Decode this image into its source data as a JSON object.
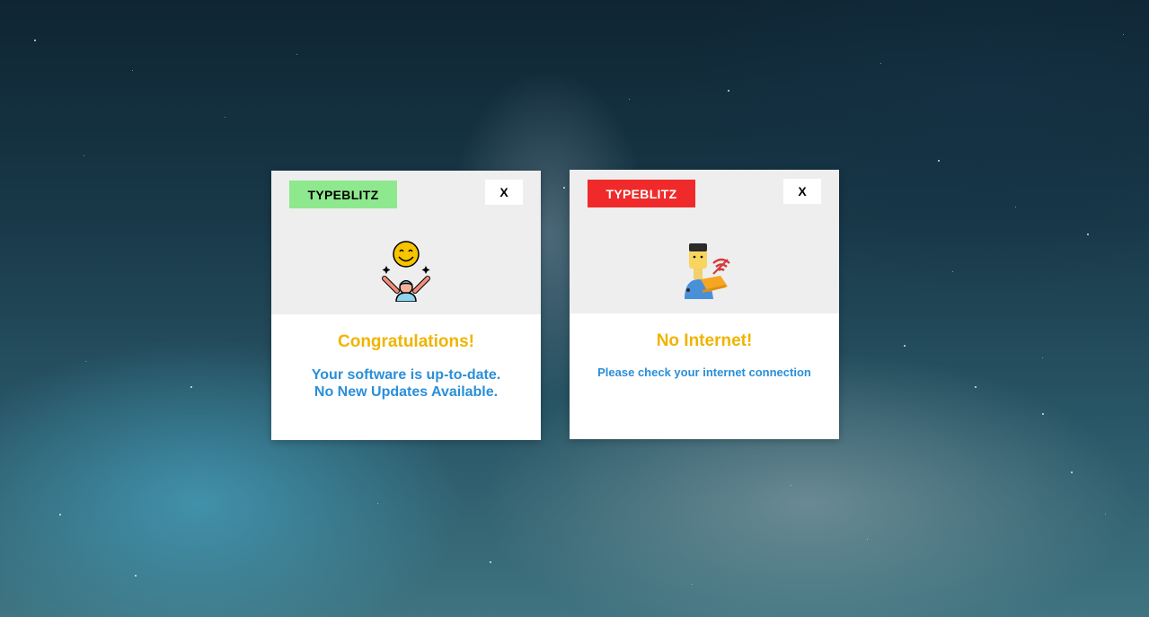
{
  "dialogs": [
    {
      "brand": "TYPEBLITZ",
      "brand_color": "#8ee88e",
      "close_label": "X",
      "icon": "celebrating-person-icon",
      "headline": "Congratulations!",
      "message_line1": "Your software is up-to-date.",
      "message_line2": "No New Updates Available."
    },
    {
      "brand": "TYPEBLITZ",
      "brand_color": "#f02a2a",
      "close_label": "X",
      "icon": "person-wifi-laptop-icon",
      "headline": "No Internet!",
      "message_line1": "Please check your internet connection"
    }
  ],
  "colors": {
    "headline": "#f0b400",
    "message": "#2a8fd8",
    "panel_top": "#eeeeee"
  }
}
